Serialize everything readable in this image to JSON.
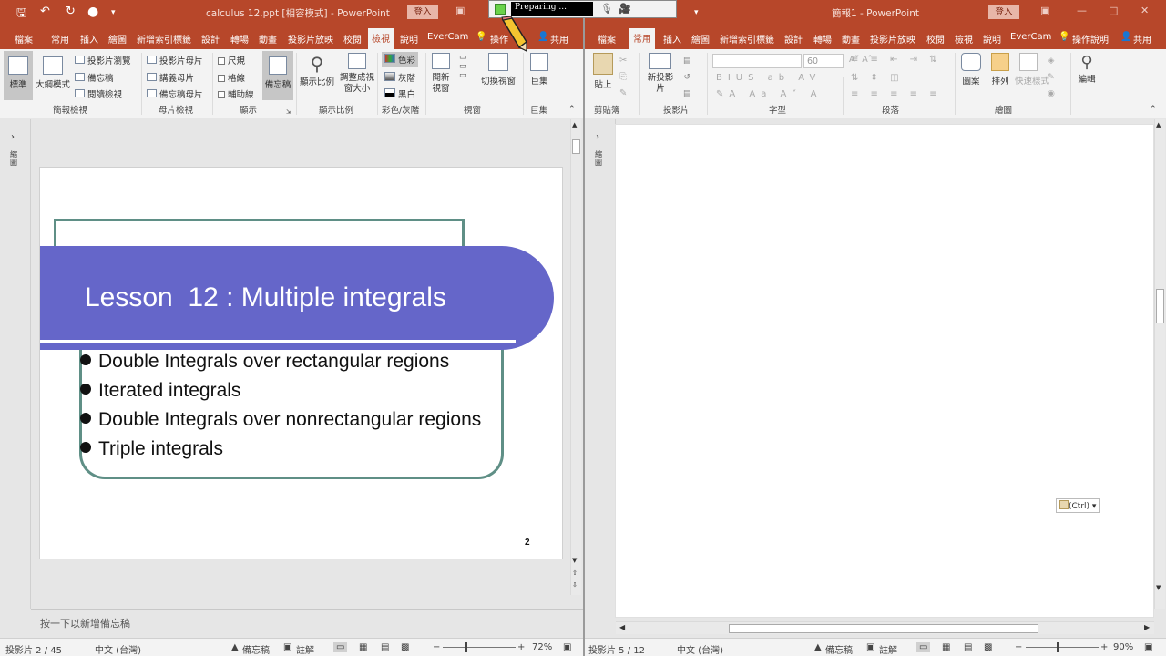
{
  "left": {
    "title": "calculus 12.ppt [相容模式] - PowerPoint",
    "signin": "登入",
    "menu": [
      "檔案",
      "常用",
      "插入",
      "繪圖",
      "新增索引標籤",
      "設計",
      "轉場",
      "動畫",
      "投影片放映",
      "校閱",
      "檢視",
      "說明",
      "EverCam",
      "操作",
      "共用"
    ],
    "ribbon": {
      "normal": "標準",
      "outline": "大綱模式",
      "slide_sorter": "投影片瀏覽",
      "notes_page": "備忘稿",
      "reading_view": "閱讀檢視",
      "slide_master": "投影片母片",
      "handout_master": "講義母片",
      "notes_master": "備忘稿母片",
      "ruler": "尺規",
      "gridlines": "格線",
      "guides": "輔助線",
      "notes": "備忘稿",
      "zoom": "顯示比例",
      "fit_window": "調整成視窗大小",
      "color": "色彩",
      "grayscale": "灰階",
      "bw": "黑白",
      "new_window": "開新視窗",
      "switch_windows": "切換視窗",
      "macros": "巨集",
      "groups": [
        "簡報檢視",
        "母片檢視",
        "顯示",
        "顯示比例",
        "彩色/灰階",
        "視窗",
        "巨集"
      ]
    },
    "thumb_label": "縮圖",
    "slide": {
      "title": "Lesson  12 : Multiple integrals",
      "bullets": [
        "Double Integrals over rectangular regions",
        "Iterated integrals",
        "Double Integrals over nonrectangular regions",
        "Triple integrals"
      ],
      "page_num": "2",
      "colors": {
        "banner": "#6566c9",
        "frame": "#5f8f86"
      }
    },
    "notes_placeholder": "按一下以新增備忘稿",
    "status": {
      "slide": "投影片 2 / 45",
      "lang": "中文 (台灣)",
      "notes": "備忘稿",
      "comments": "註解",
      "zoom": "72%"
    }
  },
  "right": {
    "title": "簡報1 - PowerPoint",
    "signin": "登入",
    "menu": [
      "檔案",
      "常用",
      "插入",
      "繪圖",
      "新增索引標籤",
      "設計",
      "轉場",
      "動畫",
      "投影片放映",
      "校閱",
      "檢視",
      "說明",
      "EverCam",
      "操作說明",
      "共用"
    ],
    "ribbon": {
      "paste": "貼上",
      "new_slide": "新投影片",
      "font_size": "60",
      "shapes": "圖案",
      "arrange": "排列",
      "quick_styles": "快速樣式",
      "editing": "編輯",
      "groups": [
        "剪貼簿",
        "投影片",
        "字型",
        "段落",
        "繪圖"
      ]
    },
    "thumb_label": "縮圖",
    "paste_tag": "(Ctrl)",
    "status": {
      "slide": "投影片 5 / 12",
      "lang": "中文 (台灣)",
      "notes": "備忘稿",
      "comments": "註解",
      "zoom": "90%"
    }
  },
  "recorder": {
    "status": "Preparing ..."
  }
}
